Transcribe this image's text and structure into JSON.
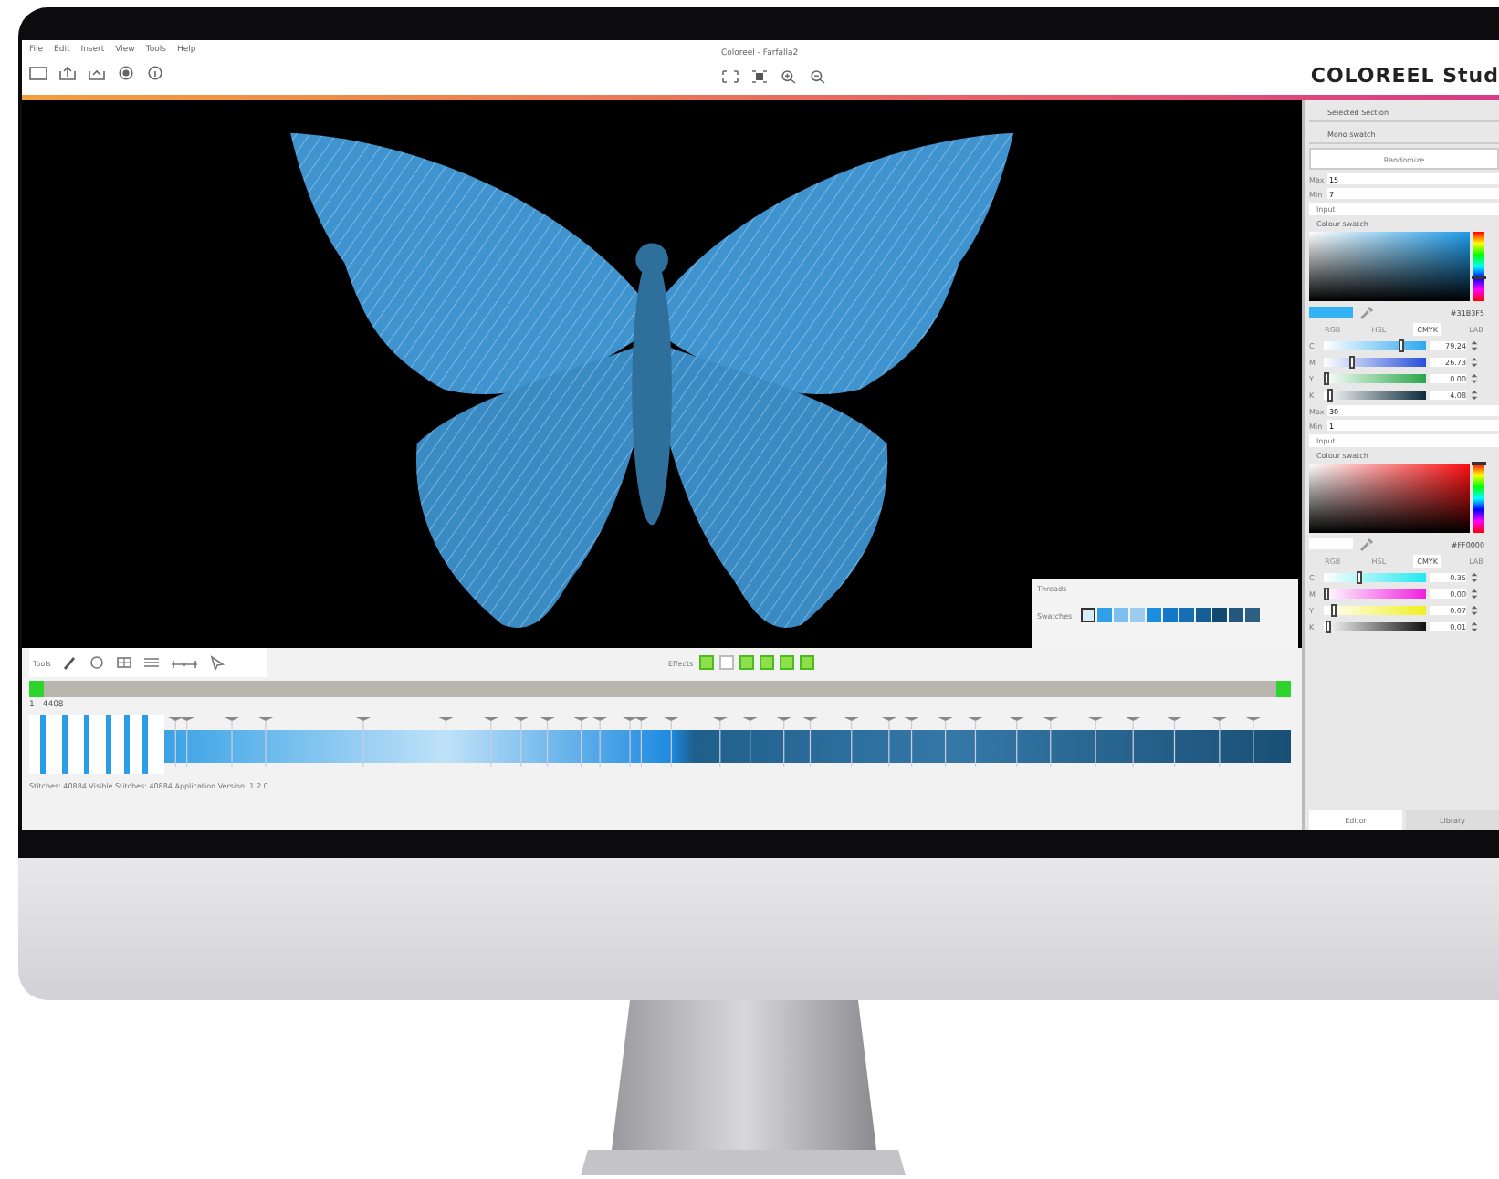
{
  "menu": [
    "File",
    "Edit",
    "Insert",
    "View",
    "Tools",
    "Help"
  ],
  "window": {
    "title": "Coloreel - Farfalla2"
  },
  "brand": "COLOREEL Stud",
  "right_panel": {
    "section": "Selected Section",
    "mode": "Mono swatch",
    "button": "Randomize",
    "groups": [
      {
        "fields": [
          {
            "label": "Max",
            "value": "15"
          },
          {
            "label": "Min",
            "value": "7"
          }
        ],
        "input_label": "Input",
        "swatch_title": "Colour swatch",
        "hue": {
          "level": 0.35
        },
        "hex": "#31B3F5",
        "tabs": [
          {
            "label": "RGB",
            "selected": false
          },
          {
            "label": "HSL",
            "selected": false
          },
          {
            "label": "CMYK",
            "selected": true
          },
          {
            "label": "LAB",
            "selected": false
          }
        ],
        "channels": [
          {
            "name": "C",
            "level": 0.79,
            "reading": "79.24"
          },
          {
            "name": "M",
            "level": 0.27,
            "reading": "26.73"
          },
          {
            "name": "Y",
            "level": 0.0,
            "reading": "0.00"
          },
          {
            "name": "K",
            "level": 0.04,
            "reading": "4.08"
          }
        ]
      },
      {
        "fields": [
          {
            "label": "Max",
            "value": "30"
          },
          {
            "label": "Min",
            "value": "1"
          }
        ],
        "input_label": "Input",
        "swatch_title": "Colour swatch",
        "hue": {
          "level": 1.0
        },
        "hex": "#FF0000",
        "tabs": [
          {
            "label": "RGB",
            "selected": false
          },
          {
            "label": "HSL",
            "selected": false
          },
          {
            "label": "CMYK",
            "selected": true
          },
          {
            "label": "LAB",
            "selected": false
          }
        ],
        "channels": [
          {
            "name": "C",
            "level": 0.35,
            "reading": "0.35"
          },
          {
            "name": "M",
            "level": 0.0,
            "reading": "0.00"
          },
          {
            "name": "Y",
            "level": 0.07,
            "reading": "0.07"
          },
          {
            "name": "K",
            "level": 0.01,
            "reading": "0.01"
          }
        ]
      }
    ],
    "bottom_tabs": [
      {
        "label": "Editor",
        "selected": true
      },
      {
        "label": "Library",
        "selected": false
      }
    ]
  },
  "threads": {
    "label": "Threads",
    "swatches_label": "Swatches",
    "swatches": [
      {
        "color": "#d8ecf8",
        "selected": true
      },
      {
        "color": "#2fa0e8",
        "selected": false
      },
      {
        "color": "#7cc0ee",
        "selected": false
      },
      {
        "color": "#9ccbee",
        "selected": false
      },
      {
        "color": "#1a8de0",
        "selected": false
      },
      {
        "color": "#1478c8",
        "selected": false
      },
      {
        "color": "#166fb4",
        "selected": false
      },
      {
        "color": "#155f96",
        "selected": false
      },
      {
        "color": "#134a70",
        "selected": false
      },
      {
        "color": "#23587c",
        "selected": false
      },
      {
        "color": "#2d5f82",
        "selected": false
      }
    ]
  },
  "tools_label": "Tools",
  "effects_label": "Effects",
  "range": "1 - 4408",
  "status": "Stitches: 40884   Visible Stitches: 40884   Application Version: 1.2.0"
}
